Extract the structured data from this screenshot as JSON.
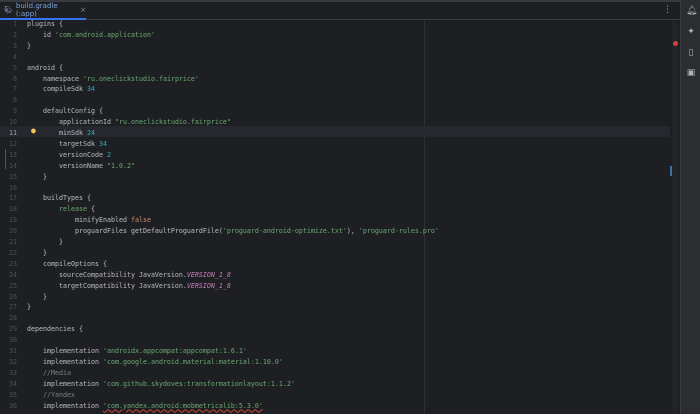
{
  "tab": {
    "label": "build.gradle (:app)",
    "close": "×",
    "icon": "gradle-elephant-icon"
  },
  "toolbar": {
    "more": "⋮"
  },
  "editor": {
    "current_line": 11,
    "lines": [
      [
        [
          "plugins {",
          "kw"
        ]
      ],
      [
        [
          "    id ",
          "kw"
        ],
        [
          "'com.android.application'",
          "str"
        ]
      ],
      [
        [
          "}",
          "kw"
        ]
      ],
      [],
      [
        [
          "android {",
          "kw"
        ]
      ],
      [
        [
          "    namespace ",
          "kw"
        ],
        [
          "'ru.oneclickstudio.fairprice'",
          "str"
        ]
      ],
      [
        [
          "    compileSdk ",
          "kw"
        ],
        [
          "34",
          "num-lit"
        ]
      ],
      [],
      [
        [
          "    defaultConfig {",
          "kw"
        ]
      ],
      [
        [
          "        applicationId ",
          "kw"
        ],
        [
          "\"ru.oneclickstudio.fairprice\"",
          "str"
        ]
      ],
      [
        [
          "        minSdk ",
          "kw"
        ],
        [
          "24",
          "num-lit"
        ]
      ],
      [
        [
          "        targetSdk ",
          "kw"
        ],
        [
          "34",
          "num-lit"
        ]
      ],
      [
        [
          "        versionCode ",
          "kw"
        ],
        [
          "2",
          "num-lit"
        ]
      ],
      [
        [
          "        versionName ",
          "kw"
        ],
        [
          "\"1.0.2\"",
          "str"
        ]
      ],
      [
        [
          "    }",
          "kw"
        ]
      ],
      [],
      [
        [
          "    buildTypes {",
          "kw"
        ]
      ],
      [
        [
          "        ",
          "kw"
        ],
        [
          "release",
          "str"
        ],
        [
          " {",
          "kw"
        ]
      ],
      [
        [
          "            minifyEnabled ",
          "kw"
        ],
        [
          "false",
          "bool"
        ]
      ],
      [
        [
          "            proguardFiles getDefaultProguardFile(",
          "kw"
        ],
        [
          "'proguard-android-optimize.txt'",
          "str"
        ],
        [
          "), ",
          "kw"
        ],
        [
          "'proguard-rules.pro'",
          "str"
        ]
      ],
      [
        [
          "        }",
          "kw"
        ]
      ],
      [
        [
          "    }",
          "kw"
        ]
      ],
      [
        [
          "    compileOptions {",
          "kw"
        ]
      ],
      [
        [
          "        sourceCompatibility JavaVersion.",
          "kw"
        ],
        [
          "VERSION_1_8",
          "ital"
        ]
      ],
      [
        [
          "        targetCompatibility JavaVersion.",
          "kw"
        ],
        [
          "VERSION_1_8",
          "ital"
        ]
      ],
      [
        [
          "    }",
          "kw"
        ]
      ],
      [
        [
          "}",
          "kw"
        ]
      ],
      [],
      [
        [
          "dependencies {",
          "kw"
        ]
      ],
      [],
      [
        [
          "    implementation ",
          "kw"
        ],
        [
          "'androidx.appcompat:appcompat:1.6.1'",
          "str"
        ]
      ],
      [
        [
          "    implementation ",
          "kw"
        ],
        [
          "'com.google.android.material:material:1.10.0'",
          "str"
        ]
      ],
      [
        [
          "    //Media",
          "cm"
        ]
      ],
      [
        [
          "    implementation ",
          "kw"
        ],
        [
          "'com.github.skydoves:transformationlayout:1.1.2'",
          "str"
        ]
      ],
      [
        [
          "    //Yandex",
          "cm"
        ]
      ],
      [
        [
          "    implementation ",
          "kw"
        ],
        [
          "'com.yandex.android:mobmetricalib:5.3.0'",
          "str err"
        ]
      ]
    ]
  },
  "right_bar": {
    "icons": [
      "notifications-icon",
      "gemini-icon",
      "device-manager-icon",
      "running-devices-icon"
    ]
  }
}
